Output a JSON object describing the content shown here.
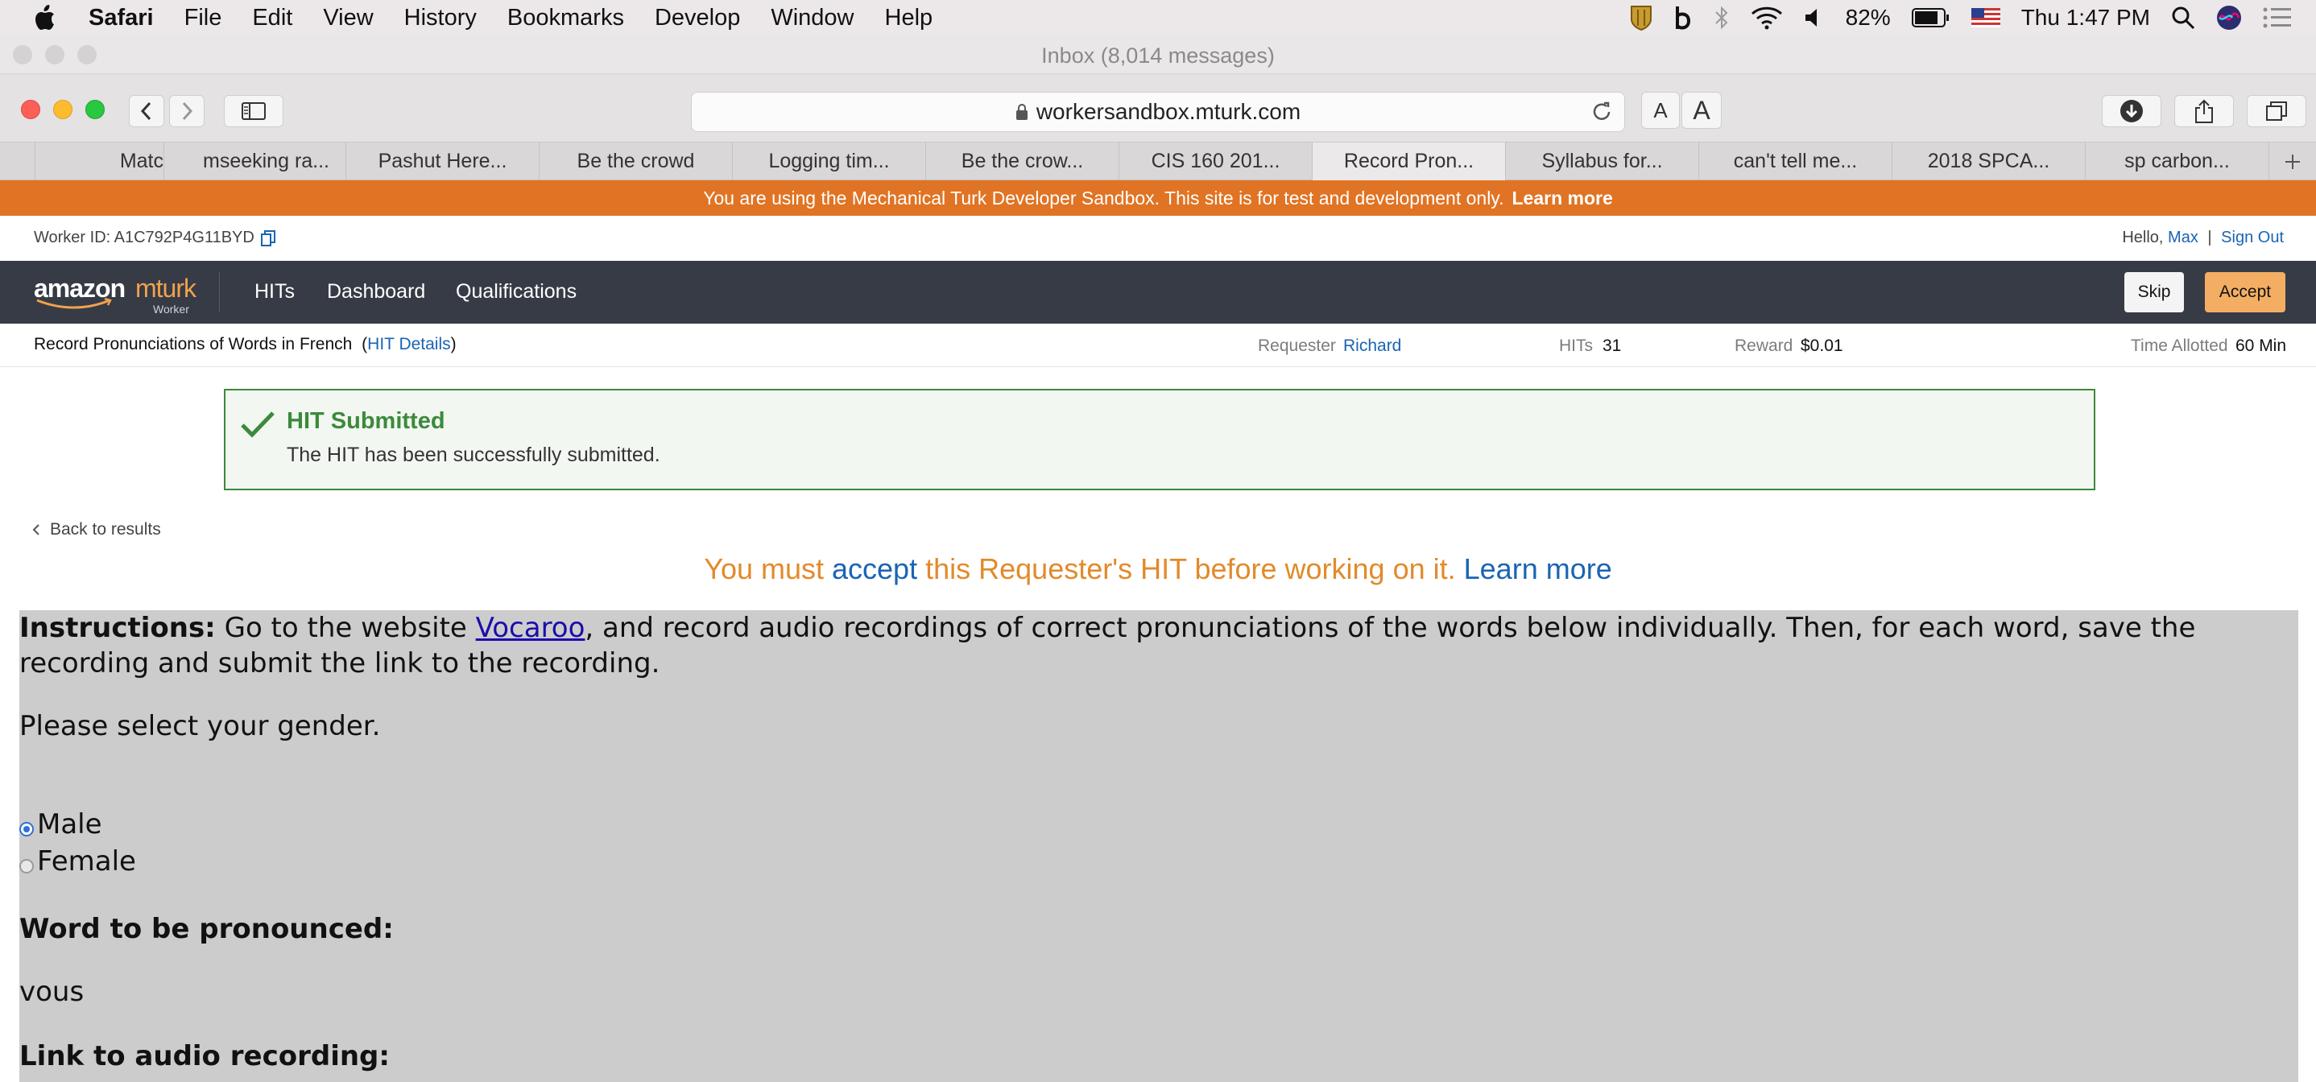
{
  "menubar": {
    "items": [
      "Safari",
      "File",
      "Edit",
      "View",
      "History",
      "Bookmarks",
      "Develop",
      "Window",
      "Help"
    ],
    "battery": "82%",
    "clock": "Thu 1:47 PM"
  },
  "window": {
    "title": "Inbox (8,014 messages)"
  },
  "toolbar": {
    "url": "workersandbox.mturk.com"
  },
  "tabs": [
    {
      "label": ""
    },
    {
      "label": "Matc"
    },
    {
      "label": "mseeking ra..."
    },
    {
      "label": "Pashut Here..."
    },
    {
      "label": "Be the crowd"
    },
    {
      "label": "Logging tim..."
    },
    {
      "label": "Be the crow..."
    },
    {
      "label": "CIS 160 201..."
    },
    {
      "label": "Record Pron..."
    },
    {
      "label": "Syllabus for..."
    },
    {
      "label": "can't tell me..."
    },
    {
      "label": "2018 SPCA..."
    },
    {
      "label": "sp carbon..."
    }
  ],
  "banner": {
    "text": "You are using the Mechanical Turk Developer Sandbox. This site is for test and development only.",
    "link": "Learn more"
  },
  "worker": {
    "id_label": "Worker ID: A1C792P4G11BYD",
    "hello": "Hello,",
    "name": "Max",
    "separator": "|",
    "sign_out": "Sign Out"
  },
  "nav": {
    "logo_amazon": "amazon",
    "logo_mturk": "mturk",
    "logo_worker": "Worker",
    "links": [
      "HITs",
      "Dashboard",
      "Qualifications"
    ],
    "skip": "Skip",
    "accept": "Accept"
  },
  "hit": {
    "title": "Record Pronunciations of Words in French",
    "details_open": "(",
    "details_link": "HIT Details",
    "details_close": ")",
    "requester_label": "Requester",
    "requester": "Richard",
    "hits_label": "HITs",
    "hits": "31",
    "reward_label": "Reward",
    "reward": "$0.01",
    "time_label": "Time Allotted",
    "time": "60 Min"
  },
  "alert": {
    "title": "HIT Submitted",
    "message": "The HIT has been successfully submitted."
  },
  "back_link": "Back to results",
  "notice": {
    "pre": "You must",
    "accept": "accept",
    "mid": "this Requester's HIT before working on it.",
    "learn": "Learn more"
  },
  "content": {
    "instructions_label": "Instructions:",
    "instructions_pre": "Go to the website",
    "vocaroo": "Vocaroo",
    "instructions_post": ", and record audio recordings of correct pronunciations of the words below individually. Then, for each word, save the recording and submit the link to the recording.",
    "gender_question": "Please select your gender.",
    "options": [
      {
        "label": "Male",
        "checked": true
      },
      {
        "label": "Female",
        "checked": false
      }
    ],
    "word_label": "Word to be pronounced:",
    "word": "vous",
    "link_label": "Link to audio recording:"
  },
  "colors": {
    "sandbox_orange": "#e07424",
    "nav_bg": "#363b45",
    "accept_orange": "#f3ae64",
    "success_green": "#3b8a3b",
    "link_blue": "#1a64b3",
    "content_gray": "#cccccc"
  },
  "icons": {
    "apple": "apple-icon",
    "lock": "lock-icon",
    "reload": "reload-icon",
    "check": "checkmark-icon",
    "copy": "copy-icon",
    "back": "chevron-left-icon"
  }
}
